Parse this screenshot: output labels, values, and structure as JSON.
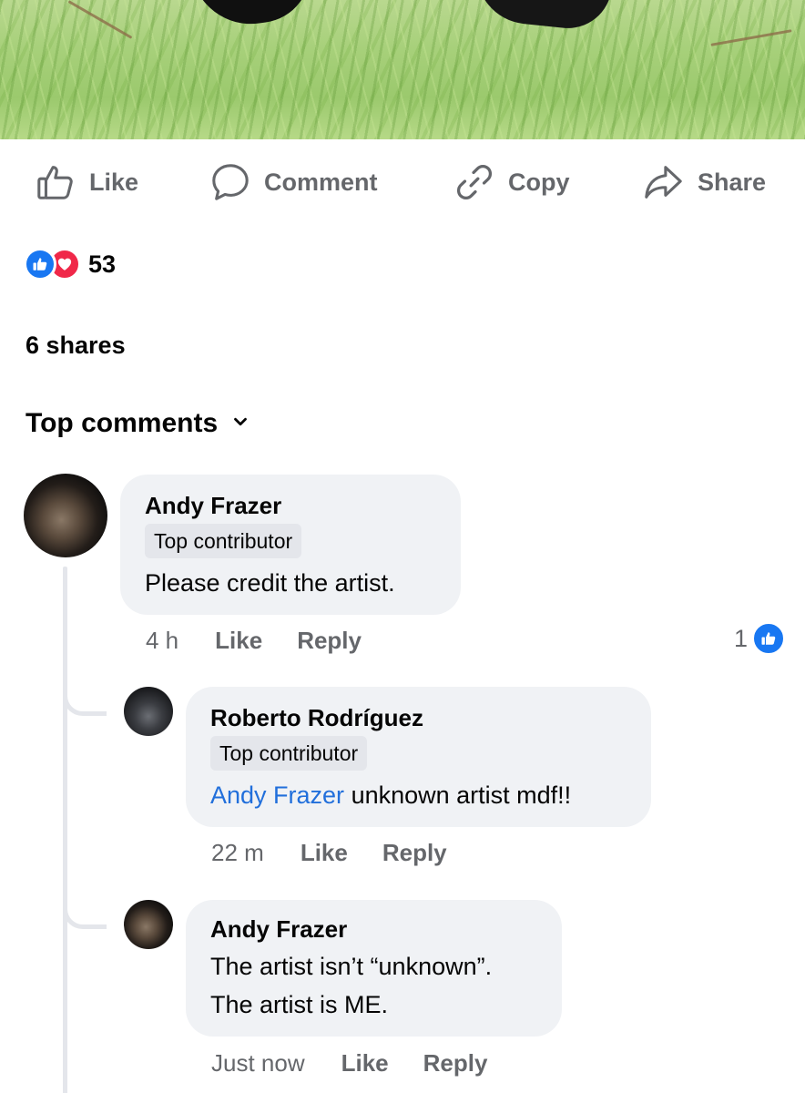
{
  "actions": {
    "like": "Like",
    "comment": "Comment",
    "copy": "Copy",
    "share": "Share"
  },
  "reactions": {
    "count": "53",
    "types": [
      "like",
      "love"
    ]
  },
  "shares": "6 shares",
  "comments_header": "Top comments",
  "comments": [
    {
      "author": "Andy Frazer",
      "badge": "Top contributor",
      "text": "Please credit the artist.",
      "time": "4 h",
      "like_label": "Like",
      "reply_label": "Reply",
      "like_count": "1"
    },
    {
      "author": "Roberto Rodríguez",
      "badge": "Top contributor",
      "mention": "Andy Frazer",
      "text": " unknown artist mdf!!",
      "time": "22 m",
      "like_label": "Like",
      "reply_label": "Reply"
    },
    {
      "author": "Andy Frazer",
      "text_line1": "The artist isn’t “unknown”.",
      "text_line2": "The artist is ME.",
      "time": "Just now",
      "like_label": "Like",
      "reply_label": "Reply"
    }
  ],
  "colors": {
    "accent": "#1877f2",
    "love": "#f02849",
    "secondary_text": "#65676b",
    "bubble": "#f0f2f5",
    "mention": "#216fdb"
  }
}
